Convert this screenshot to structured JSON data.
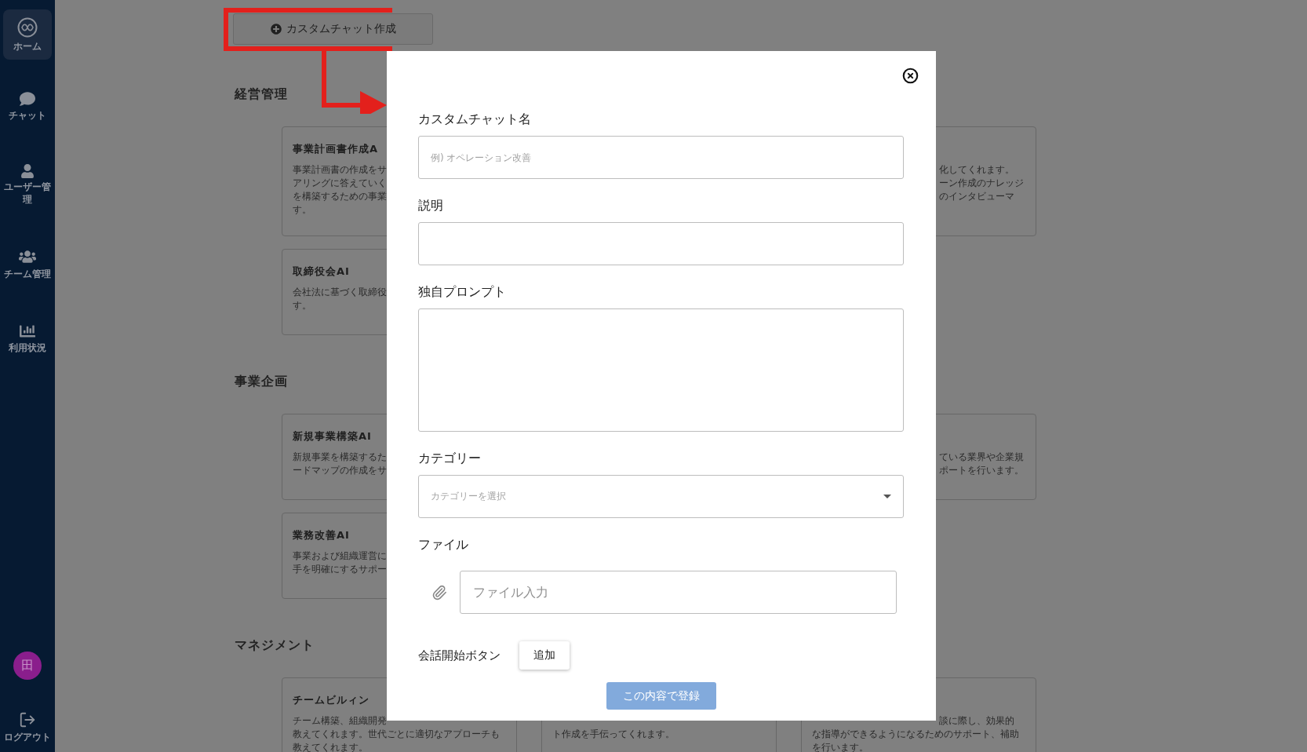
{
  "sidebar": {
    "items": [
      {
        "label": "ホーム",
        "selected": true
      },
      {
        "label": "チャット",
        "selected": false
      },
      {
        "label": "ユーザー管理",
        "selected": false
      },
      {
        "label": "チーム管理",
        "selected": false
      },
      {
        "label": "利用状況",
        "selected": false
      }
    ],
    "avatar": "田",
    "logout": "ログアウト"
  },
  "create_button": "カスタムチャット作成",
  "sections": [
    {
      "title": "経営管理",
      "cards": [
        {
          "kind": "full",
          "title": "事業計画書作成A",
          "lines": [
            {
              "text": "事業計画書の作成をサ"
            },
            {
              "text": "アリングに答えていく"
            },
            {
              "text": "を構築するための事業"
            },
            {
              "text": "す。"
            }
          ]
        },
        {
          "kind": "right_part",
          "lines": [
            {
              "text": "化してくれます。",
              "covered_left": true
            },
            {
              "text": "ーン作成のナレッジ",
              "covered_left": true
            },
            {
              "text": "のインタビューマ",
              "covered_left": true
            }
          ]
        },
        {
          "kind": "full",
          "title": "取締役会AI",
          "lines": [
            {
              "text": "会社法に基づく取締役"
            },
            {
              "text": "す。"
            }
          ]
        }
      ]
    },
    {
      "title": "事業企画",
      "cards": [
        {
          "kind": "full",
          "title": "新規事業構築AI",
          "lines": [
            {
              "text": "新規事業を構築するた"
            },
            {
              "text": "ードマップの作成をサ"
            }
          ]
        },
        {
          "kind": "right_part",
          "lines": [
            {
              "text": "ている業界や企業規",
              "covered_left": true
            },
            {
              "text": "ポートを行います。",
              "covered_left": true
            }
          ]
        },
        {
          "kind": "full",
          "title": "業務改善AI",
          "lines": [
            {
              "text": "事業および組織運営に"
            },
            {
              "text": "手を明確にするサポー"
            }
          ]
        }
      ]
    },
    {
      "title": "マネジメント",
      "cards": [
        {
          "kind": "full",
          "title": "チームビルィン",
          "lines": [
            {
              "text": "チーム構築、組織開発"
            },
            {
              "text": "教えてくれます。世代ごとに適切なアプローチも"
            },
            {
              "text": "教えてくれます。"
            }
          ]
        },
        {
          "kind": "bottom_part",
          "lines": [
            {
              "text": "ト作成を手伝ってくれます。"
            }
          ]
        },
        {
          "kind": "right_part",
          "lines": [
            {
              "text": "談に際し、効果的",
              "covered_left": true
            },
            {
              "text": "な指導ができるようになるためのサポート、補助"
            },
            {
              "text": "を行います。"
            }
          ]
        }
      ]
    }
  ],
  "modal": {
    "fields": [
      {
        "kind": "text",
        "label": "カスタムチャット名",
        "placeholder": "例) オペレーション改善"
      },
      {
        "kind": "text",
        "label": "説明"
      },
      {
        "kind": "textarea",
        "label": "独自プロンプト"
      },
      {
        "kind": "select",
        "label": "カテゴリー",
        "placeholder": "カテゴリーを選択"
      },
      {
        "kind": "file",
        "label": "ファイル",
        "placeholder": "ファイル入力"
      }
    ],
    "start_label": "会話開始ボタン",
    "add_button": "追加",
    "submit": {
      "label": "この内容で登録",
      "disabled": true
    }
  }
}
